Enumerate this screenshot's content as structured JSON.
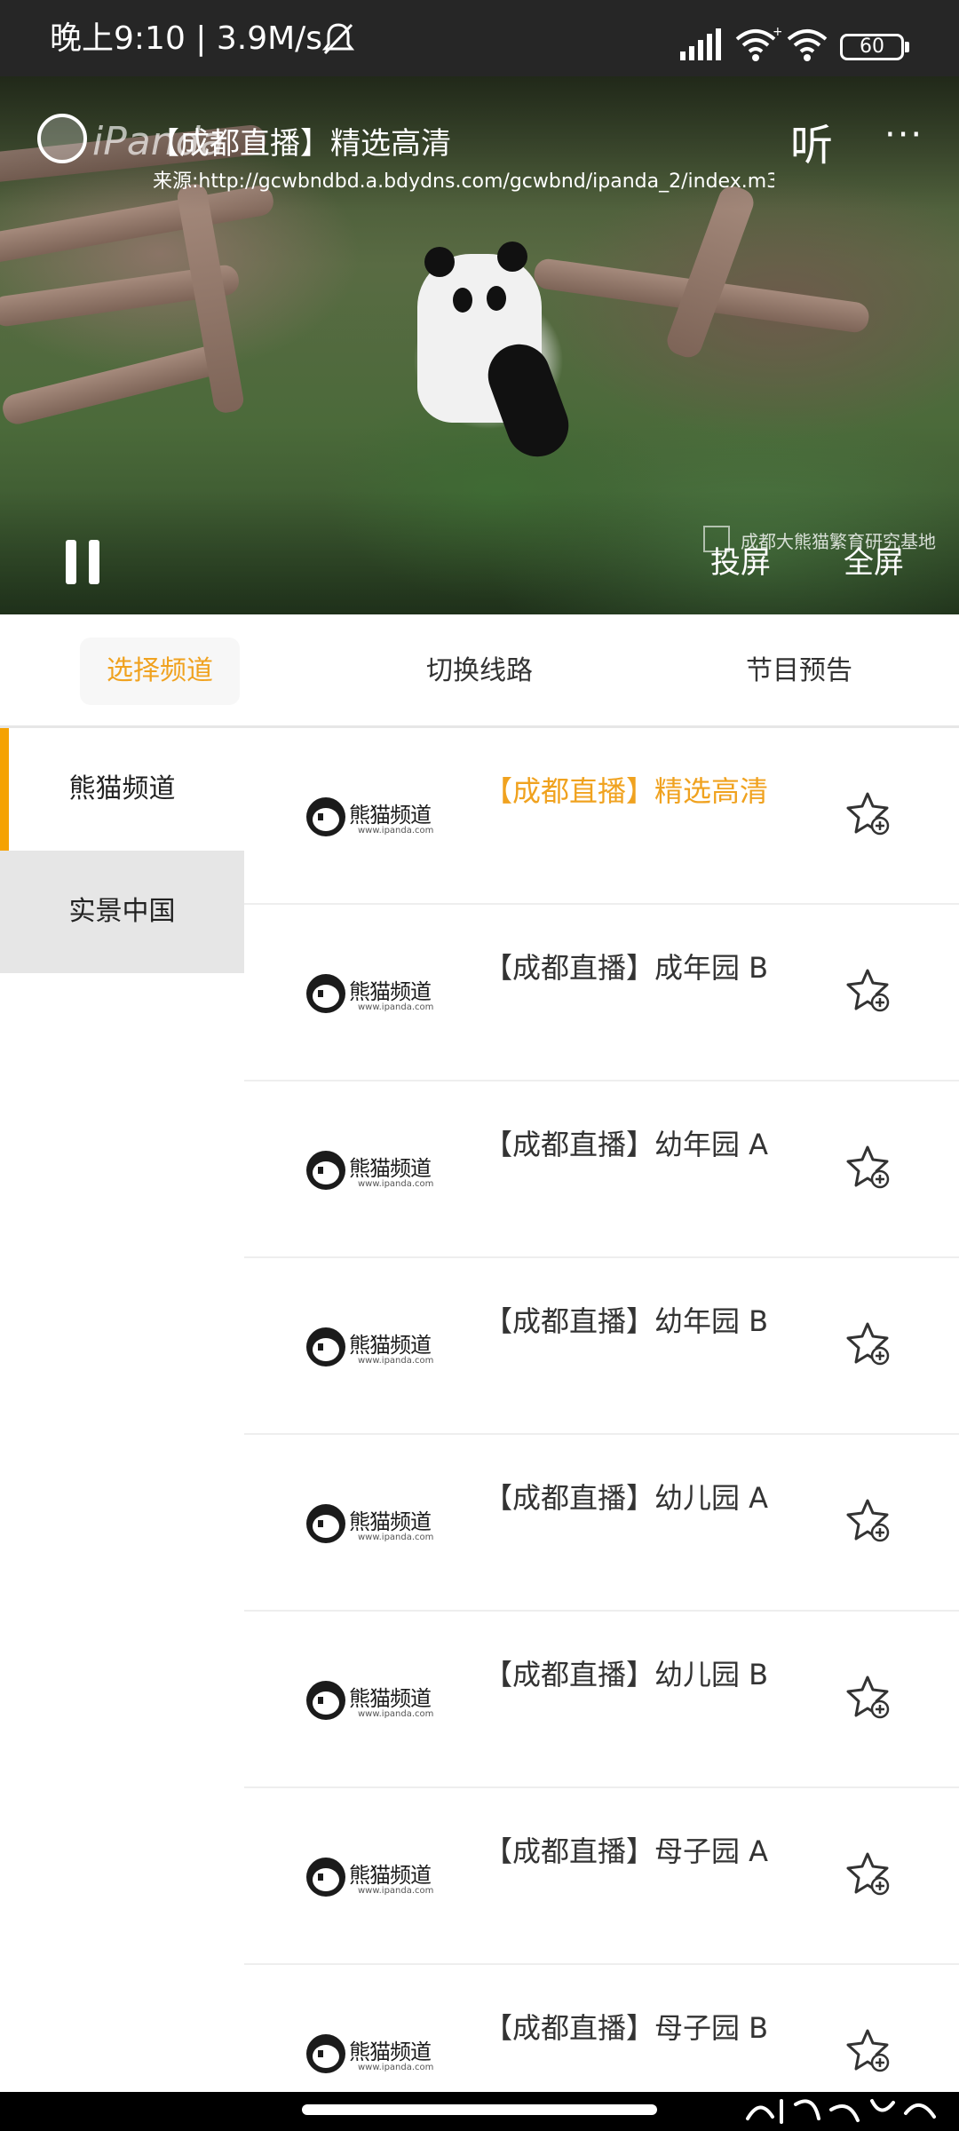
{
  "status_bar": {
    "time": "晚上9:10 | 3.9M/s",
    "battery": "60"
  },
  "player": {
    "logo_text": "iPanda",
    "title": "【成都直播】精选高清",
    "source": "来源:http://gcwbndbd.a.bdydns.com/gcwbnd/ipanda_2/index.m3...",
    "listen_label": "听",
    "more_label": "···",
    "watermark": "成都大熊猫繁育研究基地",
    "cast_label": "投屏",
    "fullscreen_label": "全屏"
  },
  "tabs": [
    {
      "label": "选择频道",
      "active": true
    },
    {
      "label": "切换线路",
      "active": false
    },
    {
      "label": "节目预告",
      "active": false
    }
  ],
  "sidebar": {
    "items": [
      {
        "label": "熊猫频道",
        "active": true
      },
      {
        "label": "实景中国",
        "active": false
      }
    ]
  },
  "channels": {
    "brand": "熊猫频道",
    "brand_url": "www.ipanda.com",
    "items": [
      {
        "name": "【成都直播】精选高清",
        "active": true
      },
      {
        "name": "【成都直播】成年园 B",
        "active": false
      },
      {
        "name": "【成都直播】幼年园 A",
        "active": false
      },
      {
        "name": "【成都直播】幼年园 B",
        "active": false
      },
      {
        "name": "【成都直播】幼儿园 A",
        "active": false
      },
      {
        "name": "【成都直播】幼儿园 B",
        "active": false
      },
      {
        "name": "【成都直播】母子园 A",
        "active": false
      },
      {
        "name": "【成都直播】母子园 B",
        "active": false
      }
    ]
  },
  "colors": {
    "accent": "#f0a21f",
    "sidebar_bar": "#f5a200",
    "status_bar_bg": "#262626"
  }
}
